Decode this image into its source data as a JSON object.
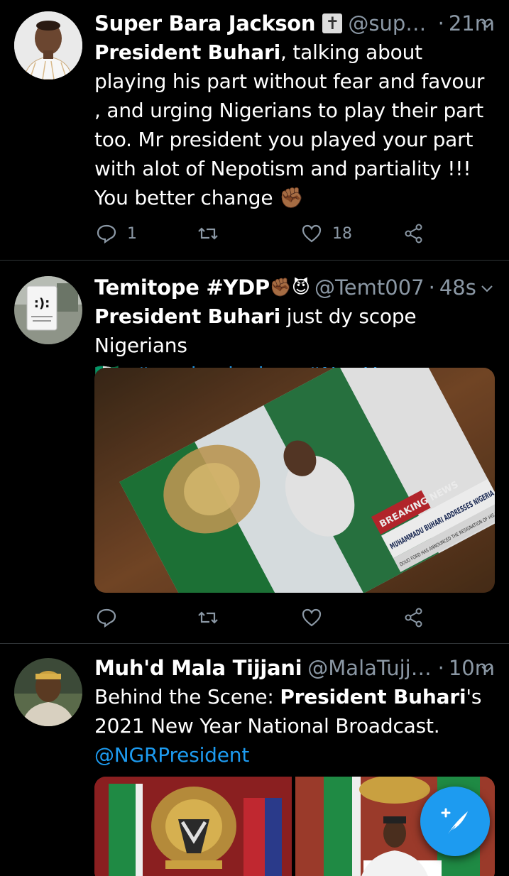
{
  "tweets": [
    {
      "author_name": "Super Bara Jackson",
      "author_emoji": "✝",
      "handle": "@supa...",
      "time": "21m",
      "text_parts": {
        "bold1": "President Buhari",
        "rest1": ", talking about playing his part without fear and favour  , and urging Nigerians to play their part too. Mr president you played your part with alot of Nepotism and partiality !!! You better change",
        "emoji": "✊🏾"
      },
      "replies": "1",
      "retweets": "",
      "likes": "18"
    },
    {
      "author_name": "Temitope #YDP",
      "author_emoji": "✊🏾😈",
      "handle": "@Temt007",
      "time": "48s",
      "text_parts": {
        "bold1": "President Buhari",
        "rest1": " just dy scope Nigerians",
        "flag": "🇳🇬",
        "hashtag1": "#newbeginnings",
        "hashtag2": "#NewYear"
      },
      "media_labels": {
        "banner": "BREAKING NEWS",
        "headline": "MUHAMMADU BUHARI ADDRESSES NIGERIA",
        "ticker": "DOUG FORD HAS ANNOUNCED THE RESIGNATION OF HIS FINA"
      },
      "replies": "",
      "retweets": "",
      "likes": ""
    },
    {
      "author_name": "Muh'd Mala Tijjani",
      "handle": "@MalaTujja...",
      "time": "10m",
      "text_parts": {
        "rest0": "Behind the Scene: ",
        "bold1": "President Buhari",
        "rest1": "'s 2021 New Year National Broadcast.",
        "mention": "@NGRPresident"
      }
    }
  ],
  "icons": {
    "reply": "reply-icon",
    "retweet": "retweet-icon",
    "like": "heart-icon",
    "share": "share-icon",
    "compose": "compose-tweet-icon"
  },
  "colors": {
    "background": "#000000",
    "accent": "#1d9bf0",
    "secondary_text": "#8b98a5",
    "divider": "#2f3336"
  }
}
